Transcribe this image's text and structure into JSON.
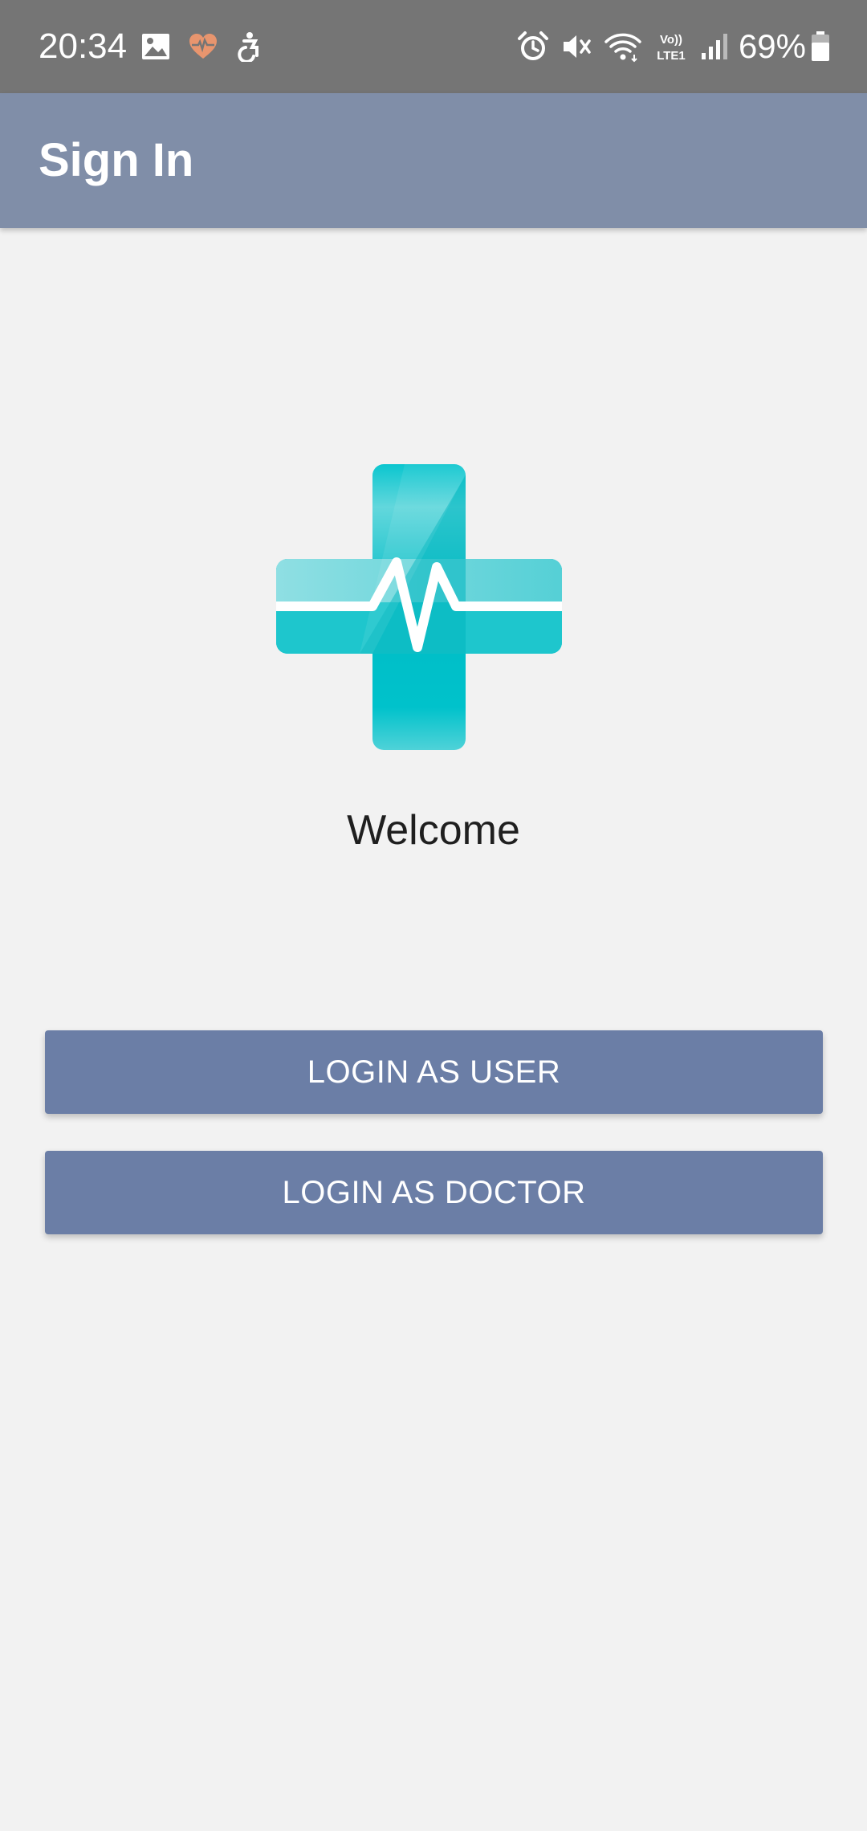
{
  "status_bar": {
    "time": "20:34",
    "battery_percent": "69%",
    "battery_level": 0.69,
    "network_label_top": "Vo))",
    "network_label_bottom": "LTE1",
    "icons": [
      "image-icon",
      "heart-rate-icon",
      "accessibility-icon",
      "alarm-icon",
      "mute-icon",
      "wifi-icon",
      "volte-icon",
      "signal-icon",
      "battery-icon"
    ],
    "heart_color": "#e8956e"
  },
  "app_bar": {
    "title": "Sign In",
    "background_color": "#808ea8"
  },
  "main": {
    "logo_icon": "medical-cross-pulse-icon",
    "welcome_text": "Welcome",
    "buttons": [
      {
        "label": "LOGIN AS USER"
      },
      {
        "label": "LOGIN AS DOCTOR"
      }
    ],
    "button_color": "#6b7ea6",
    "logo_color": "#00bcc6"
  }
}
